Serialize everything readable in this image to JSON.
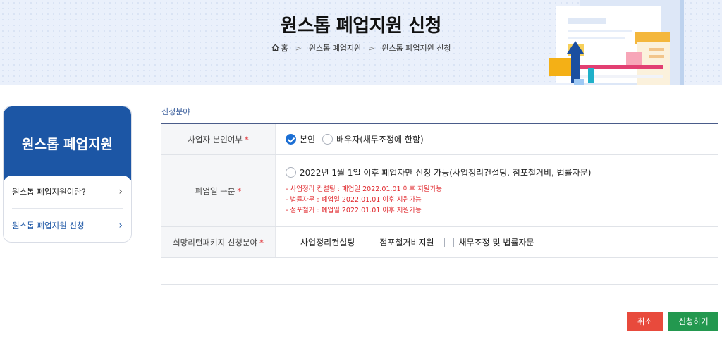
{
  "header": {
    "title": "원스톱 폐업지원 신청",
    "breadcrumb": [
      "홈",
      "원스톱 폐업지원",
      "원스톱 폐업지원 신청"
    ]
  },
  "sidebar": {
    "title": "원스톱 폐업지원",
    "items": [
      {
        "label": "원스톱 폐업지원이란?"
      },
      {
        "label": "원스톱 폐업지원 신청"
      }
    ]
  },
  "form": {
    "section_label": "신청분야",
    "rows": [
      {
        "label": "사업자 본인여부",
        "required": "*",
        "options": [
          {
            "label": "본인",
            "checked": true
          },
          {
            "label": "배우자(채무조정에 한함)",
            "checked": false
          }
        ]
      },
      {
        "label": "폐업일 구분",
        "required": "*",
        "option": "2022년 1월 1일 이후 폐업자만 신청 가능(사업정리컨설팅, 점포철거비, 법률자문)",
        "notes": [
          "- 사업정리 컨설팅 : 폐업일 2022.01.01 이후 지원가능",
          "- 법률자문 : 폐업일 2022.01.01 이후 지원가능",
          "- 점포철거 : 폐업일 2022.01.01 이후 지원가능"
        ]
      },
      {
        "label": "희망리턴패키지 신청분야",
        "required": "*",
        "checkboxes": [
          "사업정리컨설팅",
          "점포철거비지원",
          "채무조정 및 법률자문"
        ]
      }
    ]
  },
  "buttons": {
    "cancel": "취소",
    "apply": "신청하기"
  },
  "colors": {
    "primary": "#1c56a5",
    "cancel": "#e84a3c",
    "apply": "#23984f",
    "required": "#e0282d"
  }
}
